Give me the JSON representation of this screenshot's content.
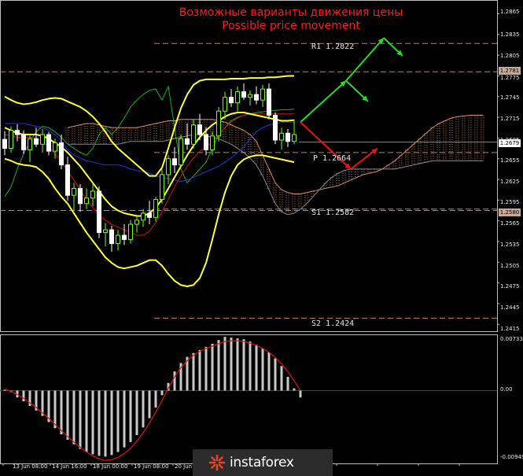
{
  "titles": {
    "ru": "Возможные варианты движения цены",
    "en": "Possible price movement"
  },
  "levels": [
    {
      "name": "R1",
      "label": "R1 1.2822",
      "value": 1.2822
    },
    {
      "name": "P",
      "label": "P 1.2664",
      "value": 1.2664
    },
    {
      "name": "S1",
      "label": "S1 1.2582",
      "value": 1.2582
    },
    {
      "name": "S2",
      "label": "S2 1.2424",
      "value": 1.2424
    }
  ],
  "price_axis": {
    "ticks": [
      "1.2865",
      "1.2835",
      "1.2805",
      "1.2775",
      "1.2745",
      "1.2715",
      "1.2685",
      "1.2655",
      "1.2625",
      "1.2595",
      "1.2565",
      "1.2535",
      "1.2505",
      "1.2475",
      "1.2445",
      "1.2415"
    ],
    "boxed": [
      {
        "label": "1.2781",
        "value": 1.2781
      },
      {
        "label": "1.2679",
        "value": 1.2679
      },
      {
        "label": "1.2580",
        "value": 1.258
      }
    ]
  },
  "time_axis": {
    "ticks": [
      "13 Jun 08:00",
      "14 Jun 16:00",
      "18 Jun 00:00",
      "19 Jun 08:00",
      "20 Jun"
    ]
  },
  "watermark": {
    "text": "instaforex"
  },
  "chart_data": [
    {
      "type": "candlestick",
      "title": "Возможные варианты движения цены / Possible price movement",
      "ylim": [
        1.2405,
        1.2885
      ],
      "candles": [
        [
          1.2683,
          1.2695,
          1.266,
          1.267
        ],
        [
          1.267,
          1.2702,
          1.2664,
          1.2696
        ],
        [
          1.2696,
          1.2705,
          1.268,
          1.269
        ],
        [
          1.269,
          1.2696,
          1.2662,
          1.2668
        ],
        [
          1.2668,
          1.269,
          1.265,
          1.2684
        ],
        [
          1.2684,
          1.27,
          1.2672,
          1.2676
        ],
        [
          1.2676,
          1.2698,
          1.2664,
          1.269
        ],
        [
          1.269,
          1.2694,
          1.266,
          1.2666
        ],
        [
          1.2666,
          1.2684,
          1.2655,
          1.2678
        ],
        [
          1.2678,
          1.269,
          1.264,
          1.2646
        ],
        [
          1.2646,
          1.2658,
          1.2594,
          1.2602
        ],
        [
          1.2602,
          1.262,
          1.258,
          1.2612
        ],
        [
          1.2612,
          1.2618,
          1.2578,
          1.259
        ],
        [
          1.259,
          1.2612,
          1.2582,
          1.2598
        ],
        [
          1.2598,
          1.262,
          1.2586,
          1.2608
        ],
        [
          1.2608,
          1.2615,
          1.254,
          1.2548
        ],
        [
          1.2548,
          1.2562,
          1.2528,
          1.2552
        ],
        [
          1.2552,
          1.2558,
          1.252,
          1.2532
        ],
        [
          1.2532,
          1.2552,
          1.2522,
          1.2544
        ],
        [
          1.2544,
          1.256,
          1.253,
          1.2538
        ],
        [
          1.2538,
          1.2566,
          1.2532,
          1.256
        ],
        [
          1.256,
          1.2574,
          1.2548,
          1.2566
        ],
        [
          1.2566,
          1.2582,
          1.2556,
          1.2576
        ],
        [
          1.2576,
          1.2594,
          1.256,
          1.257
        ],
        [
          1.257,
          1.26,
          1.2564,
          1.2596
        ],
        [
          1.2596,
          1.264,
          1.259,
          1.2632
        ],
        [
          1.2632,
          1.266,
          1.2618,
          1.2655
        ],
        [
          1.2655,
          1.2672,
          1.2634,
          1.2646
        ],
        [
          1.2646,
          1.269,
          1.2642,
          1.2684
        ],
        [
          1.2684,
          1.2706,
          1.2668,
          1.2676
        ],
        [
          1.2676,
          1.2712,
          1.267,
          1.2704
        ],
        [
          1.2704,
          1.272,
          1.2682,
          1.269
        ],
        [
          1.269,
          1.27,
          1.266,
          1.2668
        ],
        [
          1.2668,
          1.2694,
          1.266,
          1.2688
        ],
        [
          1.2688,
          1.273,
          1.268,
          1.2724
        ],
        [
          1.2724,
          1.2752,
          1.2712,
          1.2744
        ],
        [
          1.2744,
          1.2756,
          1.273,
          1.2736
        ],
        [
          1.2736,
          1.276,
          1.2724,
          1.2752
        ],
        [
          1.2752,
          1.2764,
          1.274,
          1.2744
        ],
        [
          1.2744,
          1.2754,
          1.2732,
          1.2748
        ],
        [
          1.2748,
          1.276,
          1.2734,
          1.274
        ],
        [
          1.274,
          1.2762,
          1.273,
          1.2756
        ],
        [
          1.2756,
          1.2764,
          1.2712,
          1.2718
        ],
        [
          1.2718,
          1.2722,
          1.2676,
          1.2682
        ],
        [
          1.2682,
          1.27,
          1.2668,
          1.2692
        ],
        [
          1.2692,
          1.2698,
          1.2672,
          1.268
        ],
        [
          1.268,
          1.2712,
          1.2676,
          1.269
        ]
      ],
      "bollinger_upper": [
        1.2745,
        1.274,
        1.2736,
        1.2734,
        1.2735,
        1.2737,
        1.274,
        1.2742,
        1.2743,
        1.2742,
        1.2738,
        1.2734,
        1.273,
        1.2724,
        1.2716,
        1.2706,
        1.2694,
        1.268,
        1.267,
        1.2662,
        1.2654,
        1.2646,
        1.2638,
        1.263,
        1.263,
        1.2642,
        1.267,
        1.27,
        1.2728,
        1.2748,
        1.2762,
        1.2768,
        1.277,
        1.277,
        1.277,
        1.277,
        1.2771,
        1.2771,
        1.2771,
        1.2772,
        1.2772,
        1.2772,
        1.2773,
        1.2773,
        1.2774,
        1.2775,
        1.2775
      ],
      "bollinger_middle": [
        1.27,
        1.2696,
        1.2692,
        1.269,
        1.269,
        1.269,
        1.2688,
        1.2684,
        1.2678,
        1.2672,
        1.2664,
        1.2654,
        1.2644,
        1.2632,
        1.262,
        1.2608,
        1.2596,
        1.2586,
        1.258,
        1.2576,
        1.2574,
        1.2572,
        1.2572,
        1.2576,
        1.2584,
        1.2596,
        1.2612,
        1.2628,
        1.2644,
        1.266,
        1.2674,
        1.2686,
        1.2696,
        1.2704,
        1.271,
        1.2716,
        1.272,
        1.2722,
        1.2722,
        1.272,
        1.2718,
        1.2716,
        1.2714,
        1.2712,
        1.271,
        1.271,
        1.2711
      ],
      "bollinger_lower": [
        1.2655,
        1.2652,
        1.2648,
        1.2646,
        1.2645,
        1.2643,
        1.2636,
        1.2626,
        1.2612,
        1.26,
        1.259,
        1.2576,
        1.2562,
        1.2548,
        1.2536,
        1.2524,
        1.2512,
        1.2504,
        1.2498,
        1.2496,
        1.2498,
        1.25,
        1.2504,
        1.2508,
        1.2508,
        1.25,
        1.2488,
        1.2478,
        1.2472,
        1.247,
        1.2472,
        1.2482,
        1.2504,
        1.2538,
        1.2574,
        1.2606,
        1.263,
        1.2646,
        1.2654,
        1.2658,
        1.266,
        1.266,
        1.2658,
        1.2656,
        1.2654,
        1.2652,
        1.265
      ],
      "red_line": [
        1.269,
        1.2688,
        1.2686,
        1.2686,
        1.2686,
        1.2685,
        1.268,
        1.2672,
        1.2662,
        1.265,
        1.2638,
        1.2624,
        1.261,
        1.2596,
        1.2584,
        1.2574,
        1.2566,
        1.256,
        1.2556,
        1.2552,
        1.2548,
        1.2544,
        1.2544,
        1.255,
        1.2562,
        1.2578,
        1.2596,
        1.2614,
        1.263,
        1.2644,
        1.2656,
        1.2666,
        1.2672,
        1.268,
        1.269,
        1.27,
        1.2708,
        1.2714,
        1.2718,
        1.272,
        1.272,
        1.272,
        1.272,
        1.272,
        1.272,
        1.272,
        1.272
      ],
      "blue_line": [
        1.2706,
        1.2706,
        1.2706,
        1.2706,
        1.2704,
        1.2702,
        1.27,
        1.2696,
        1.269,
        1.268,
        1.2668,
        1.266,
        1.2656,
        1.2652,
        1.265,
        1.2648,
        1.2646,
        1.2646,
        1.2646,
        1.2644,
        1.264,
        1.2638,
        1.2636,
        1.2634,
        1.263,
        1.2628,
        1.2626,
        1.2624,
        1.2622,
        1.2624,
        1.2628,
        1.2632,
        1.2636,
        1.264,
        1.2644,
        1.265,
        1.2656,
        1.2664,
        1.2672,
        1.2684,
        1.2694,
        1.27,
        1.2704,
        1.2706,
        1.2708,
        1.2708,
        1.2708
      ],
      "green_line": [
        1.26,
        1.2614,
        1.264,
        1.2662,
        1.268,
        1.2694,
        1.2702,
        1.27,
        1.2694,
        1.2686,
        1.2676,
        1.267,
        1.2664,
        1.266,
        1.267,
        1.269,
        1.27,
        1.269,
        1.27,
        1.2714,
        1.273,
        1.274,
        1.2748,
        1.2754,
        1.2756,
        1.274,
        1.276,
        1.27,
        1.264,
        1.262,
        1.263,
        1.264,
        1.265,
        1.267,
        1.269,
        1.27,
        1.271,
        1.2715,
        1.2718,
        1.272,
        1.2722,
        1.2723,
        1.2724,
        1.2725,
        1.2726,
        1.2726,
        1.2727
      ],
      "cloud_span_a": [
        1.27,
        1.2702,
        1.2704,
        1.2706,
        1.2706,
        1.2704,
        1.2702,
        1.27,
        1.27,
        1.27,
        1.27,
        1.27,
        1.2702,
        1.2704,
        1.2706,
        1.2708,
        1.271,
        1.271,
        1.2712,
        1.2712,
        1.2712,
        1.2712,
        1.2712,
        1.2712,
        1.271,
        1.2708,
        1.2704,
        1.27,
        1.2696,
        1.269,
        1.268,
        1.266,
        1.264,
        1.262,
        1.261,
        1.2606,
        1.2604,
        1.2604,
        1.2606,
        1.2608,
        1.261,
        1.2612,
        1.2614,
        1.2616,
        1.262,
        1.2624,
        1.2628,
        1.2632,
        1.2634,
        1.2636,
        1.264,
        1.2646,
        1.2652,
        1.266,
        1.2668,
        1.2676,
        1.2684,
        1.2692,
        1.27,
        1.2706,
        1.271,
        1.2714,
        1.2716,
        1.2717,
        1.2718,
        1.2718,
        1.2718
      ],
      "cloud_span_b": [
        1.2676,
        1.2676,
        1.2676,
        1.2676,
        1.2676,
        1.2676,
        1.2676,
        1.2676,
        1.2676,
        1.2678,
        1.268,
        1.268,
        1.268,
        1.268,
        1.268,
        1.268,
        1.2682,
        1.2684,
        1.2686,
        1.2688,
        1.269,
        1.269,
        1.2688,
        1.2686,
        1.2684,
        1.268,
        1.2676,
        1.267,
        1.2664,
        1.2656,
        1.2646,
        1.263,
        1.261,
        1.259,
        1.2578,
        1.2574,
        1.2576,
        1.2582,
        1.259,
        1.26,
        1.261,
        1.262,
        1.2628,
        1.2634,
        1.2638,
        1.264,
        1.264,
        1.264,
        1.264,
        1.264,
        1.264,
        1.264,
        1.264,
        1.2642,
        1.2644,
        1.2646,
        1.2648,
        1.265,
        1.2652,
        1.2652,
        1.2652,
        1.2652,
        1.2652,
        1.2652,
        1.2652,
        1.2652,
        1.2652
      ]
    },
    {
      "type": "histogram",
      "title": "MACD",
      "ylim": [
        -0.00949,
        0.00733
      ],
      "tick_labels": [
        "0.00733",
        "0.00",
        "-0.00949"
      ],
      "values": [
        0.0001,
        -0.0002,
        -0.0009,
        -0.0014,
        -0.002,
        -0.0026,
        -0.0033,
        -0.0041,
        -0.0049,
        -0.0057,
        -0.0064,
        -0.007,
        -0.0076,
        -0.008,
        -0.0083,
        -0.0085,
        -0.0086,
        -0.0084,
        -0.008,
        -0.0074,
        -0.0067,
        -0.0058,
        -0.0048,
        -0.0036,
        -0.0022,
        -0.0006,
        0.001,
        0.0025,
        0.0036,
        0.0044,
        0.0049,
        0.0053,
        0.0057,
        0.0061,
        0.0066,
        0.007,
        0.0069,
        0.0068,
        0.0067,
        0.0064,
        0.006,
        0.0055,
        0.005,
        0.0042,
        0.0032,
        0.0018,
        0.0003,
        -0.0009
      ],
      "signal": [
        0.0002,
        -0.0001,
        -0.0005,
        -0.001,
        -0.0016,
        -0.0022,
        -0.0029,
        -0.0036,
        -0.0044,
        -0.0052,
        -0.006,
        -0.0067,
        -0.0074,
        -0.008,
        -0.0085,
        -0.0089,
        -0.0091,
        -0.009,
        -0.0087,
        -0.0082,
        -0.0075,
        -0.0066,
        -0.0055,
        -0.0042,
        -0.0028,
        -0.0013,
        0.0003,
        0.0018,
        0.003,
        0.0039,
        0.0046,
        0.0051,
        0.0055,
        0.0058,
        0.0061,
        0.0064,
        0.0065,
        0.0065,
        0.0064,
        0.0062,
        0.0059,
        0.0055,
        0.005,
        0.0043,
        0.0035,
        0.0025,
        0.0013,
        0.0
      ]
    }
  ]
}
